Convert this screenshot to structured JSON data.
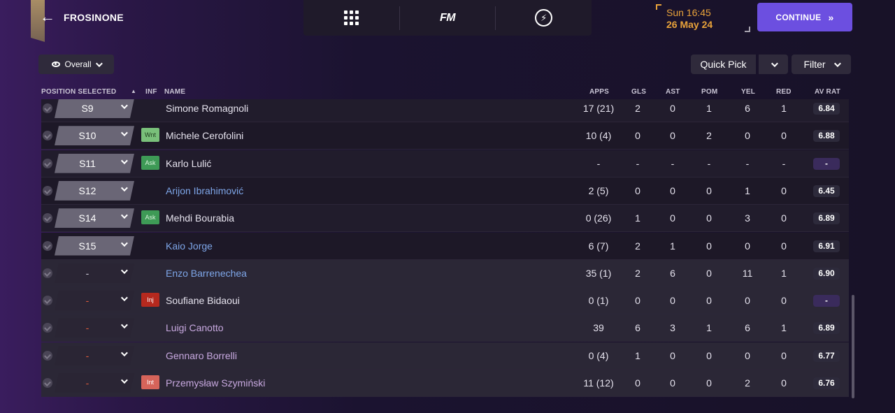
{
  "header": {
    "club_name": "FROSINONE",
    "nav": [
      {
        "name": "menu-grid-icon"
      },
      {
        "label": "FM"
      },
      {
        "name": "bolt-icon"
      }
    ],
    "date_time": "Sun 16:45",
    "date_day": "26 May 24",
    "continue_label": "CONTINUE",
    "continue_chevron": "»",
    "accent_color": "#6c4fe0",
    "date_color": "#e8a23a"
  },
  "toolbar": {
    "view_label": "Overall",
    "quick_pick_label": "Quick Pick",
    "filter_label": "Filter"
  },
  "columns": {
    "position": "POSITION SELECTED",
    "inf": "INF",
    "name": "NAME",
    "apps": "APPS",
    "gls": "GLS",
    "ast": "AST",
    "pom": "POM",
    "yel": "YEL",
    "red": "RED",
    "av_rat": "AV RAT"
  },
  "rows": [
    {
      "pos": "S9",
      "inf": "",
      "name": "Simone Romagnoli",
      "apps": "17 (21)",
      "gls": "2",
      "ast": "0",
      "pom": "1",
      "yel": "6",
      "red": "1",
      "rat": "6.84"
    },
    {
      "pos": "S10",
      "inf": "Wnt",
      "name": "Michele Cerofolini",
      "apps": "10 (4)",
      "gls": "0",
      "ast": "0",
      "pom": "2",
      "yel": "0",
      "red": "0",
      "rat": "6.88"
    },
    {
      "pos": "S11",
      "inf": "Ask",
      "name": "Karlo Lulić",
      "apps": "-",
      "gls": "-",
      "ast": "-",
      "pom": "-",
      "yel": "-",
      "red": "-",
      "rat": "-"
    },
    {
      "pos": "S12",
      "inf": "",
      "name": "Arijon Ibrahimović",
      "apps": "2 (5)",
      "gls": "0",
      "ast": "0",
      "pom": "0",
      "yel": "1",
      "red": "0",
      "rat": "6.45"
    },
    {
      "pos": "S14",
      "inf": "Ask",
      "name": "Mehdi Bourabia",
      "apps": "0 (26)",
      "gls": "1",
      "ast": "0",
      "pom": "0",
      "yel": "3",
      "red": "0",
      "rat": "6.89"
    },
    {
      "pos": "S15",
      "inf": "",
      "name": "Kaio Jorge",
      "apps": "6 (7)",
      "gls": "2",
      "ast": "1",
      "pom": "0",
      "yel": "0",
      "red": "0",
      "rat": "6.91"
    },
    {
      "pos": "-",
      "inf": "",
      "name": "Enzo Barrenechea",
      "apps": "35 (1)",
      "gls": "2",
      "ast": "6",
      "pom": "0",
      "yel": "11",
      "red": "1",
      "rat": "6.90"
    },
    {
      "pos": "-",
      "inf": "Inj",
      "name": "Soufiane Bidaoui",
      "apps": "0 (1)",
      "gls": "0",
      "ast": "0",
      "pom": "0",
      "yel": "0",
      "red": "0",
      "rat": "-"
    },
    {
      "pos": "-",
      "inf": "",
      "name": "Luigi Canotto",
      "apps": "39",
      "gls": "6",
      "ast": "3",
      "pom": "1",
      "yel": "6",
      "red": "1",
      "rat": "6.89"
    },
    {
      "pos": "-",
      "inf": "",
      "name": "Gennaro Borrelli",
      "apps": "0 (4)",
      "gls": "1",
      "ast": "0",
      "pom": "0",
      "yel": "0",
      "red": "0",
      "rat": "6.77"
    },
    {
      "pos": "-",
      "inf": "Int",
      "name": "Przemysław Szymiński",
      "apps": "11 (12)",
      "gls": "0",
      "ast": "0",
      "pom": "0",
      "yel": "2",
      "red": "0",
      "rat": "6.76"
    }
  ]
}
